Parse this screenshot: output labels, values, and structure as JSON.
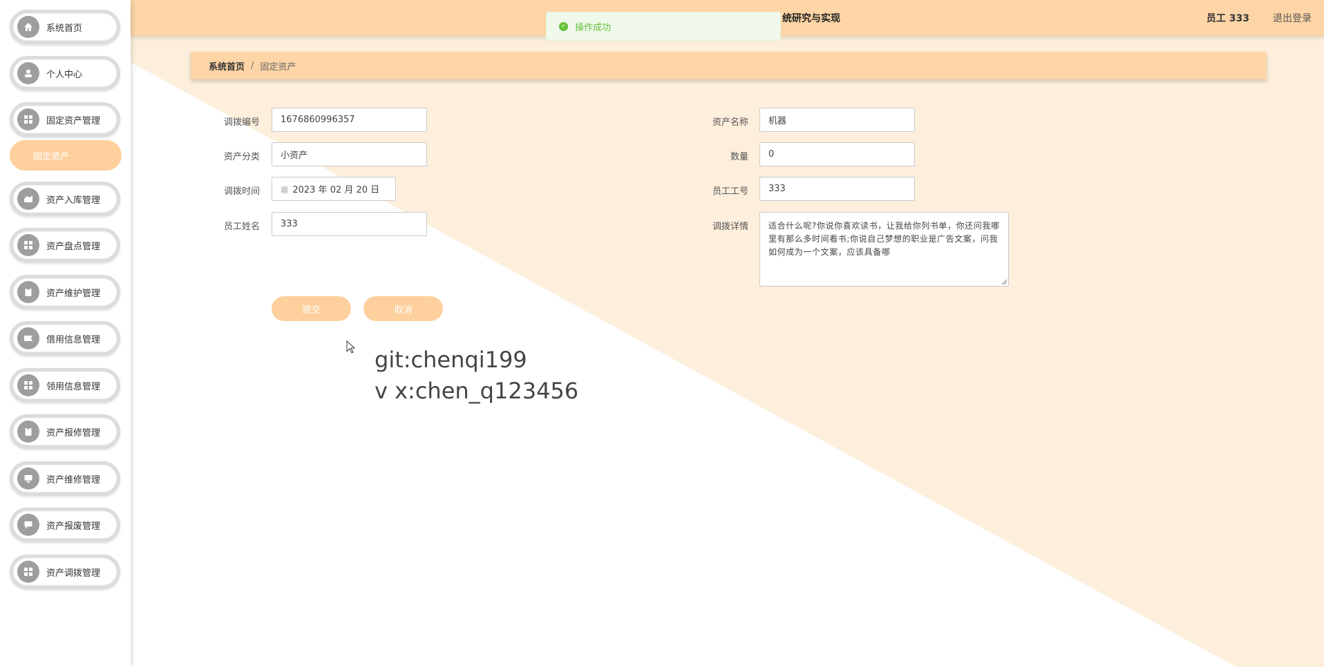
{
  "header": {
    "title": "统研究与实现",
    "user": "员工 333",
    "logout": "退出登录"
  },
  "toast": {
    "message": "操作成功"
  },
  "breadcrumb": {
    "home": "系统首页",
    "separator": "/",
    "current": "固定资产"
  },
  "sidebar": {
    "items": [
      {
        "label": "系统首页",
        "icon": "home-icon"
      },
      {
        "label": "个人中心",
        "icon": "user-icon"
      },
      {
        "label": "固定资产管理",
        "icon": "grid-icon"
      },
      {
        "label": "资产入库管理",
        "icon": "inbox-icon"
      },
      {
        "label": "资产盘点管理",
        "icon": "grid-icon"
      },
      {
        "label": "资产维护管理",
        "icon": "clipboard-icon"
      },
      {
        "label": "借用信息管理",
        "icon": "ticket-icon"
      },
      {
        "label": "领用信息管理",
        "icon": "grid-icon"
      },
      {
        "label": "资产报修管理",
        "icon": "clipboard-icon"
      },
      {
        "label": "资产维修管理",
        "icon": "monitor-icon"
      },
      {
        "label": "资产报废管理",
        "icon": "chat-icon"
      },
      {
        "label": "资产调拨管理",
        "icon": "grid-icon"
      }
    ],
    "active_sub": "固定资产"
  },
  "form": {
    "transfer_no_label": "调拨编号",
    "transfer_no": "1676860996357",
    "category_label": "资产分类",
    "category": "小资产",
    "transfer_time_label": "调拨时间",
    "transfer_time": "2023 年 02 月 20 日",
    "employee_name_label": "员工姓名",
    "employee_name": "333",
    "asset_name_label": "资产名称",
    "asset_name": "机器",
    "quantity_label": "数量",
    "quantity": "0",
    "employee_no_label": "员工工号",
    "employee_no": "333",
    "details_label": "调拨详情",
    "details": "适合什么呢?你说你喜欢读书，让我给你列书单，你还问我哪里有那么多时间看书;你说自己梦想的职业是广告文案，问我如何成为一个文案，应该具备哪",
    "submit": "提交",
    "cancel": "取消"
  },
  "watermark": {
    "line1": "git:chenqi199",
    "line2": "v x:chen_q123456"
  },
  "colors": {
    "accent": "#fdd5a6",
    "button": "#fdd09d",
    "success": "#67c23a"
  }
}
